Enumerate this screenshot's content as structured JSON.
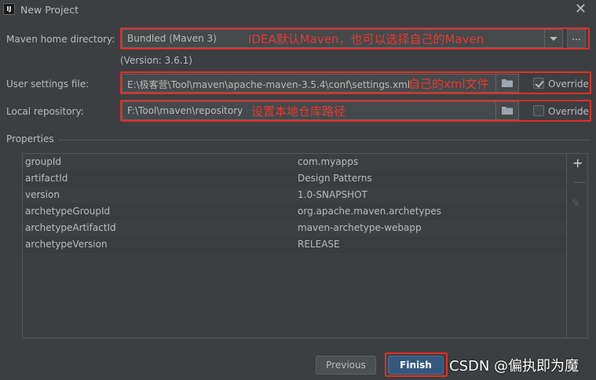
{
  "window": {
    "title": "New Project"
  },
  "maven_home": {
    "label": "Maven home directory:",
    "value": "Bundled (Maven 3)",
    "annotation": "IDEA默认Maven，也可以选择自己的Maven",
    "version": "(Version: 3.6.1)",
    "browse_label": "..."
  },
  "user_settings": {
    "label": "User settings file:",
    "value": "E:\\极客营\\Tool\\maven\\apache-maven-3.5.4\\conf\\settings.xml",
    "annotation": "自己的xml文件",
    "override_label": "Override",
    "override_checked": true
  },
  "local_repo": {
    "label": "Local repository:",
    "value": "F:\\Tool\\maven\\repository",
    "annotation": "设置本地仓库路径",
    "override_label": "Override",
    "override_checked": false
  },
  "properties": {
    "title": "Properties",
    "rows": [
      {
        "key": "groupId",
        "value": "com.myapps"
      },
      {
        "key": "artifactId",
        "value": "Design Patterns"
      },
      {
        "key": "version",
        "value": "1.0-SNAPSHOT"
      },
      {
        "key": "archetypeGroupId",
        "value": "org.apache.maven.archetypes"
      },
      {
        "key": "archetypeArtifactId",
        "value": "maven-archetype-webapp"
      },
      {
        "key": "archetypeVersion",
        "value": "RELEASE"
      }
    ]
  },
  "footer": {
    "previous_label": "Previous",
    "finish_label": "Finish",
    "watermark": "CSDN @偏执即为魔"
  },
  "colors": {
    "annotation": "#e53935",
    "highlight_box": "#e52d27",
    "primary_button": "#365880"
  }
}
